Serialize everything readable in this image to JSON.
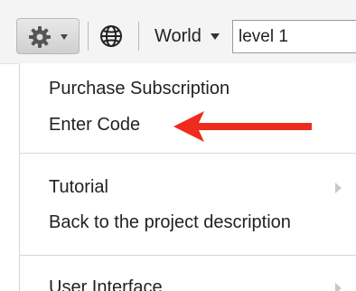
{
  "toolbar": {
    "gear_icon": "gear-icon",
    "globe_icon": "globe-icon",
    "world_label": "World",
    "level_value": "level 1"
  },
  "menu": {
    "items": [
      {
        "label": "Purchase Subscription",
        "has_submenu": false
      },
      {
        "label": "Enter Code",
        "has_submenu": false
      },
      {
        "label": "Tutorial",
        "has_submenu": true
      },
      {
        "label": "Back to the project description",
        "has_submenu": false
      },
      {
        "label": "User Interface",
        "has_submenu": true
      }
    ]
  },
  "colors": {
    "annotation_arrow": "#ee2b1c",
    "toolbar_bg": "#f4f4f4"
  }
}
